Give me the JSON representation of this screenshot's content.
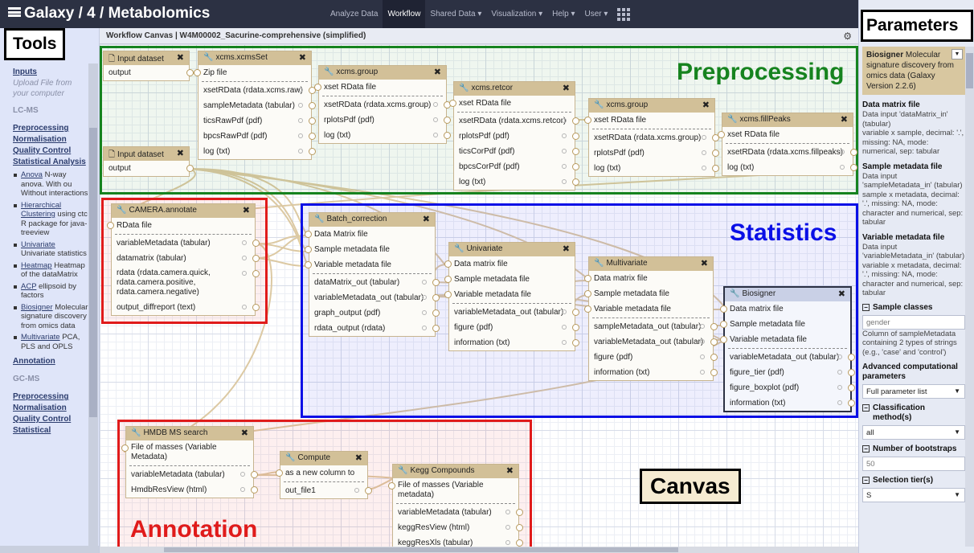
{
  "header": {
    "brand": "Galaxy / 4 / Metabolomics",
    "nav": [
      "Analyze Data",
      "Workflow",
      "Shared Data ▾",
      "Visualization ▾",
      "Help ▾",
      "User ▾"
    ],
    "active_nav": "Workflow"
  },
  "labels": {
    "tools": "Tools",
    "parameters": "Parameters",
    "canvas": "Canvas",
    "preprocessing": "Preprocessing",
    "statistics": "Statistics",
    "annotation": "Annotation"
  },
  "colors": {
    "preprocessing": "#16831f",
    "statistics": "#0a0fe6",
    "camera": "#e01b1b",
    "annotation": "#e01b1b"
  },
  "tools_panel": {
    "inputs": "Inputs",
    "upload": "Upload File from your computer",
    "lcms": "LC-MS",
    "preprocessing": "Preprocessing",
    "normalisation": "Normalisation",
    "quality_control": "Quality Control",
    "statistical_analysis": "Statistical Analysis",
    "anova_link": "Anova",
    "anova_desc": "N-way anova. With ou Without interactions",
    "hc_link": "Hierarchical Clustering",
    "hc_desc": "using ctc R package for java-treeview",
    "uni_link": "Univariate",
    "uni_desc": "Univariate statistics",
    "heat_link": "Heatmap",
    "heat_desc": "Heatmap of the dataMatrix",
    "acp_link": "ACP",
    "acp_desc": "ellipsoid by factors",
    "bios_link": "Biosigner",
    "bios_desc": "Molecular signature discovery from omics data",
    "multi_link": "Multivariate",
    "multi_desc": "PCA, PLS and OPLS",
    "annotation": "Annotation",
    "gcms": "GC-MS",
    "preprocessing2": "Preprocessing",
    "normalisation2": "Normalisation",
    "quality_control2": "Quality Control",
    "statistical2": "Statistical"
  },
  "canvas_title": "Workflow Canvas | W4M00002_Sacurine-comprehensive (simplified)",
  "nodes": {
    "input1": {
      "title": "Input dataset",
      "output": "output"
    },
    "input2": {
      "title": "Input dataset",
      "output": "output"
    },
    "xcmsset": {
      "title": "xcms.xcmsSet",
      "in": "Zip file",
      "outs": [
        "xsetRData (rdata.xcms.raw)",
        "sampleMetadata (tabular)",
        "ticsRawPdf (pdf)",
        "bpcsRawPdf (pdf)",
        "log (txt)"
      ]
    },
    "group1": {
      "title": "xcms.group",
      "in": "xset RData file",
      "outs": [
        "xsetRData (rdata.xcms.group)",
        "rplotsPdf (pdf)",
        "log (txt)"
      ]
    },
    "retcor": {
      "title": "xcms.retcor",
      "in": "xset RData file",
      "outs": [
        "xsetRData (rdata.xcms.retcor)",
        "rplotsPdf (pdf)",
        "ticsCorPdf (pdf)",
        "bpcsCorPdf (pdf)",
        "log (txt)"
      ]
    },
    "group2": {
      "title": "xcms.group",
      "in": "xset RData file",
      "outs": [
        "xsetRData (rdata.xcms.group)",
        "rplotsPdf (pdf)",
        "log (txt)"
      ]
    },
    "fillpeaks": {
      "title": "xcms.fillPeaks",
      "in": "xset RData file",
      "outs": [
        "xsetRData (rdata.xcms.fillpeaks)",
        "log (txt)"
      ]
    },
    "camera": {
      "title": "CAMERA.annotate",
      "in": "RData file",
      "outs": [
        "variableMetadata (tabular)",
        "datamatrix (tabular)",
        "rdata (rdata.camera.quick, rdata.camera.positive, rdata.camera.negative)",
        "output_diffreport (text)"
      ]
    },
    "batch": {
      "title": "Batch_correction",
      "ins": [
        "Data Matrix file",
        "Sample metadata file",
        "Variable metadata file"
      ],
      "outs": [
        "dataMatrix_out (tabular)",
        "variableMetadata_out (tabular)",
        "graph_output (pdf)",
        "rdata_output (rdata)"
      ]
    },
    "univariate": {
      "title": "Univariate",
      "ins": [
        "Data matrix file",
        "Sample metadata file",
        "Variable metadata file"
      ],
      "outs": [
        "variableMetadata_out (tabular)",
        "figure (pdf)",
        "information (txt)"
      ]
    },
    "multivariate": {
      "title": "Multivariate",
      "ins": [
        "Data matrix file",
        "Sample metadata file",
        "Variable metadata file"
      ],
      "outs": [
        "sampleMetadata_out (tabular)",
        "variableMetadata_out (tabular)",
        "figure (pdf)",
        "information (txt)"
      ]
    },
    "biosigner": {
      "title": "Biosigner",
      "ins": [
        "Data matrix file",
        "Sample metadata file",
        "Variable metadata file"
      ],
      "outs": [
        "variableMetadata_out (tabular)",
        "figure_tier (pdf)",
        "figure_boxplot (pdf)",
        "information (txt)"
      ]
    },
    "hmdb": {
      "title": "HMDB MS search",
      "in": "File of masses (Variable Metadata)",
      "outs": [
        "variableMetadata (tabular)",
        "HmdbResView (html)"
      ]
    },
    "compute": {
      "title": "Compute",
      "in": "as a new column to",
      "outs": [
        "out_file1"
      ]
    },
    "kegg": {
      "title": "Kegg Compounds",
      "in": "File of masses (Variable metadata)",
      "outs": [
        "variableMetadata (tabular)",
        "keggResView (html)",
        "keggResXls (tabular)"
      ]
    }
  },
  "params": {
    "tool_name": "Biosigner",
    "tool_desc": "Molecular signature discovery from omics data (Galaxy Version 2.2.6)",
    "dm_head": "Data matrix file",
    "dm_text": "Data input 'dataMatrix_in' (tabular)",
    "dm_desc": "variable x sample, decimal: '.', missing: NA, mode: numerical, sep: tabular",
    "sm_head": "Sample metadata file",
    "sm_text": "Data input 'sampleMetadata_in' (tabular)",
    "sm_desc": "sample x metadata, decimal: '.', missing: NA, mode: character and numerical, sep: tabular",
    "vm_head": "Variable metadata file",
    "vm_text": "Data input 'variableMetadata_in' (tabular)",
    "vm_desc": "variable x metadata, decimal: '.', missing: NA, mode: character and numerical, sep: tabular",
    "classes_head": "Sample classes",
    "classes_value": "gender",
    "classes_help": "Column of sampleMetadata containing 2 types of strings (e.g., 'case' and 'control')",
    "adv_head": "Advanced computational parameters",
    "adv_value": "Full parameter list",
    "cls_head": "Classification method(s)",
    "cls_value": "all",
    "boot_head": "Number of bootstraps",
    "boot_value": "50",
    "tier_head": "Selection tier(s)",
    "tier_value": "S"
  }
}
